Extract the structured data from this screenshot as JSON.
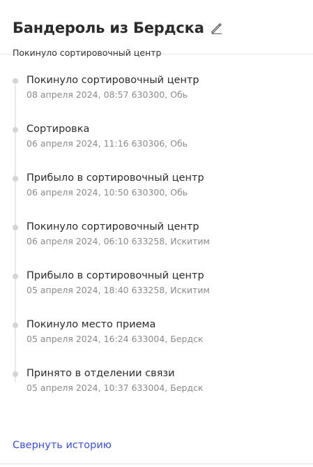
{
  "header": {
    "title": "Бандероль из Бердска",
    "subtitle": "Покинуло сортировочный центр",
    "edit_icon": "pencil-icon"
  },
  "history": [
    {
      "status": "Покинуло сортировочный центр",
      "meta": "08 апреля 2024, 08:57 630300, Обь"
    },
    {
      "status": "Сортировка",
      "meta": "06 апреля 2024, 11:16 630306, Обь"
    },
    {
      "status": "Прибыло в сортировочный центр",
      "meta": "06 апреля 2024, 10:50 630300, Обь"
    },
    {
      "status": "Покинуло сортировочный центр",
      "meta": "06 апреля 2024, 06:10 633258, Искитим"
    },
    {
      "status": "Прибыло в сортировочный центр",
      "meta": "05 апреля 2024, 18:40 633258, Искитим"
    },
    {
      "status": "Покинуло место приема",
      "meta": "05 апреля 2024, 16:24 633004, Бердск"
    },
    {
      "status": "Принято в отделении связи",
      "meta": "05 апреля 2024, 10:37 633004, Бердск"
    }
  ],
  "collapse_label": "Свернуть историю",
  "colors": {
    "link": "#3b4fd8",
    "dot": "#d4d4d4",
    "meta": "#8a8a8a"
  }
}
